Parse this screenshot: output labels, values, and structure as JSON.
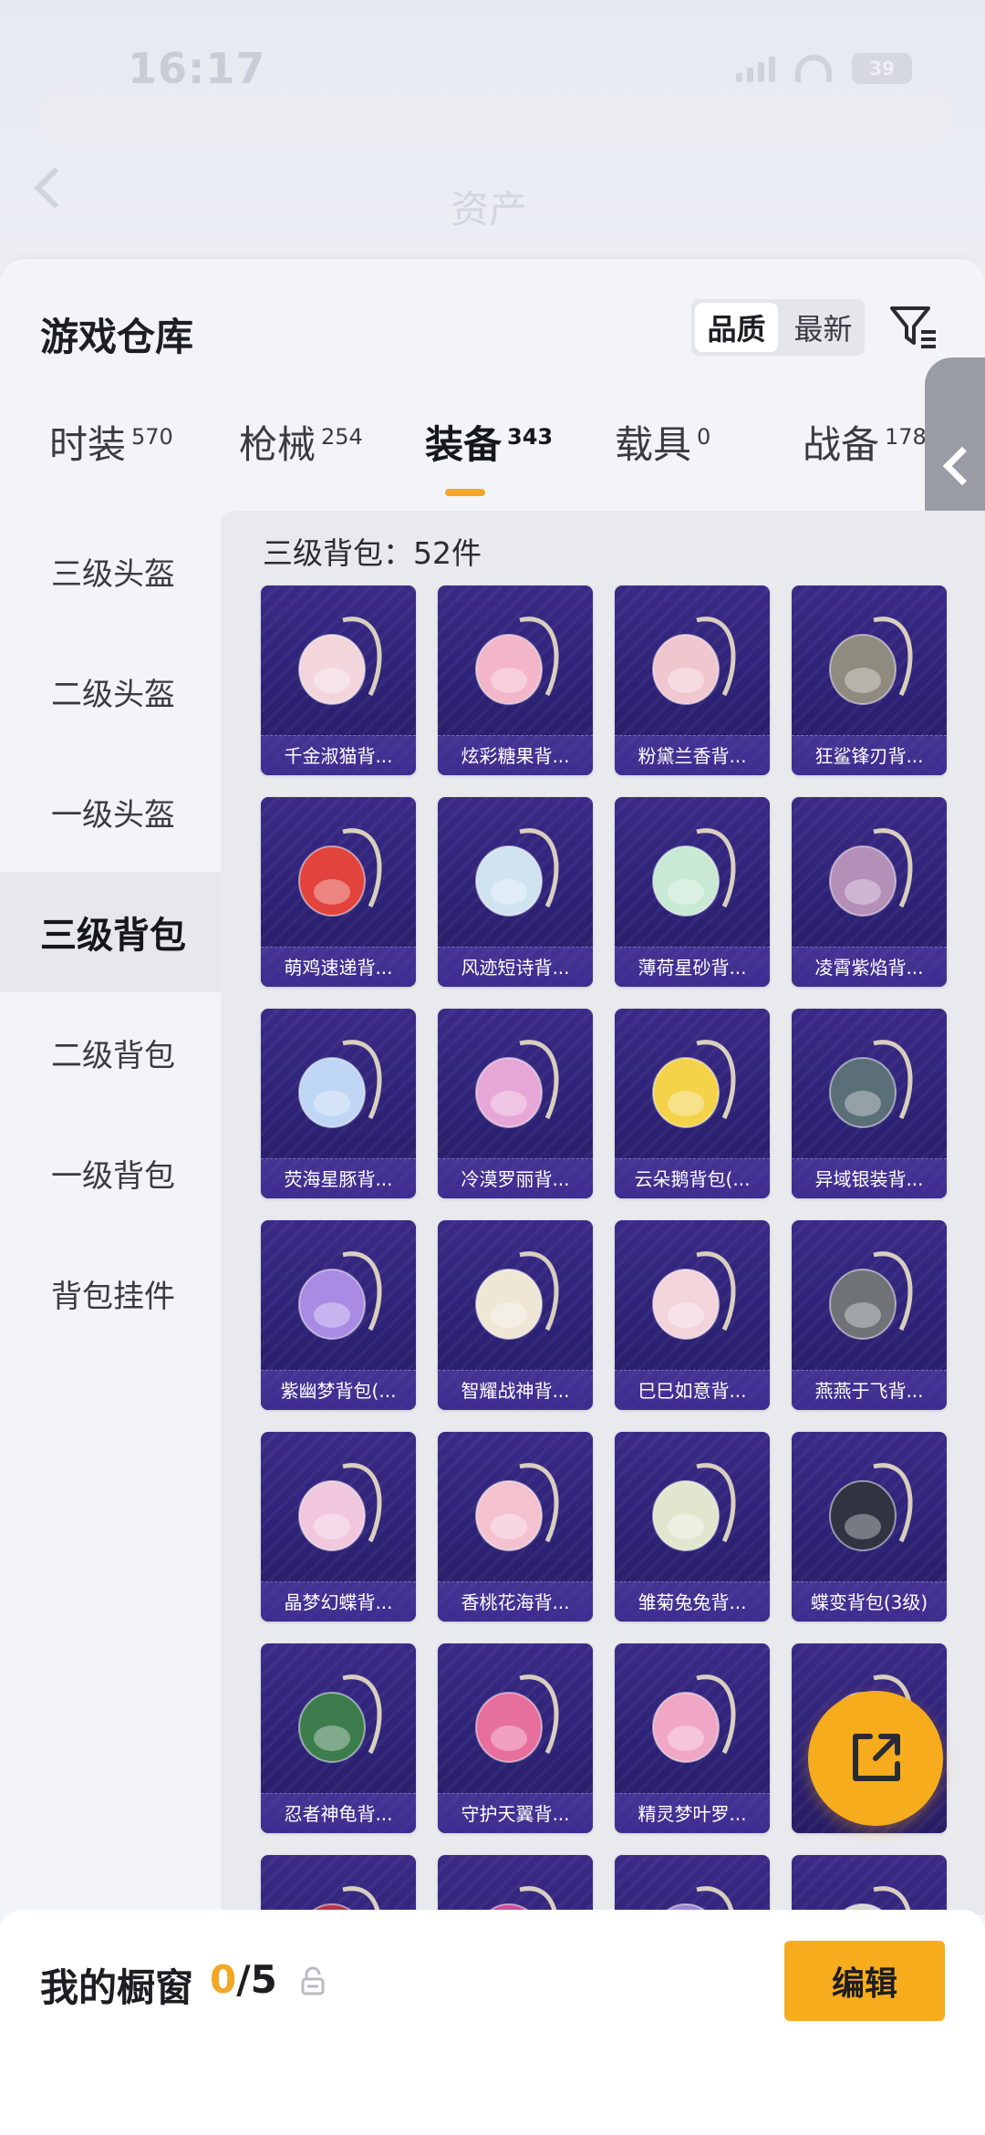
{
  "status": {
    "time": "16:17",
    "battery": "39"
  },
  "header": {
    "title": "资产"
  },
  "sheet": {
    "title": "游戏仓库",
    "sort_options": [
      {
        "label": "品质",
        "active": true
      },
      {
        "label": "最新",
        "active": false
      }
    ]
  },
  "tabs": [
    {
      "label": "时装",
      "count": "570"
    },
    {
      "label": "枪械",
      "count": "254"
    },
    {
      "label": "装备",
      "count": "343",
      "active": true
    },
    {
      "label": "载具",
      "count": "0"
    },
    {
      "label": "战备",
      "count": "178"
    }
  ],
  "categories": [
    {
      "label": "三级头盔"
    },
    {
      "label": "二级头盔"
    },
    {
      "label": "一级头盔"
    },
    {
      "label": "三级背包",
      "active": true
    },
    {
      "label": "二级背包"
    },
    {
      "label": "一级背包"
    },
    {
      "label": "背包挂件"
    }
  ],
  "group_title": "三级背包：52件",
  "items": [
    {
      "name": "千金淑猫背...",
      "color": "#f2d6dc"
    },
    {
      "name": "炫彩糖果背...",
      "color": "#f2b6c8"
    },
    {
      "name": "粉黛兰香背...",
      "color": "#f0c6cf"
    },
    {
      "name": "狂鲨锋刃背...",
      "color": "#8f8b7f"
    },
    {
      "name": "萌鸡速递背...",
      "color": "#e2433d"
    },
    {
      "name": "风迹短诗背...",
      "color": "#cfe3f1"
    },
    {
      "name": "薄荷星砂背...",
      "color": "#c8e9d3"
    },
    {
      "name": "凌霄紫焰背...",
      "color": "#b48fb8"
    },
    {
      "name": "荧海星豚背...",
      "color": "#bfd6f5"
    },
    {
      "name": "冷漠罗丽背...",
      "color": "#e6a7d6"
    },
    {
      "name": "云朵鹅背包(...",
      "color": "#f4d34a"
    },
    {
      "name": "异域银装背...",
      "color": "#5b6f78"
    },
    {
      "name": "紫幽梦背包(...",
      "color": "#a98be3"
    },
    {
      "name": "智耀战神背...",
      "color": "#efe6d6"
    },
    {
      "name": "巳巳如意背...",
      "color": "#f3d4db"
    },
    {
      "name": "燕燕于飞背...",
      "color": "#6f7378"
    },
    {
      "name": "晶梦幻蝶背...",
      "color": "#f1c7de"
    },
    {
      "name": "香桃花海背...",
      "color": "#f4c2cf"
    },
    {
      "name": "雏菊兔兔背...",
      "color": "#e3e6cf"
    },
    {
      "name": "蝶变背包(3级)",
      "color": "#2f3440"
    },
    {
      "name": "忍者神龟背...",
      "color": "#3d7d4d"
    },
    {
      "name": "守护天翼背...",
      "color": "#e76f9d"
    },
    {
      "name": "精灵梦叶罗...",
      "color": "#f0a7c6"
    },
    {
      "name": "",
      "color": "#efe9e2"
    },
    {
      "name": "",
      "color": "#b5344a"
    },
    {
      "name": "",
      "color": "#c64fa0"
    },
    {
      "name": "",
      "color": "#9a86d8"
    },
    {
      "name": "",
      "color": "#d8d4cf"
    }
  ],
  "showcase": {
    "label": "我的橱窗",
    "current": "0",
    "total": "/5"
  },
  "edit_button": "编辑",
  "icons": {
    "back": "chevron-left-icon",
    "filter": "filter-icon",
    "share": "share-icon",
    "lock": "lock-icon",
    "collapse": "chevron-left-icon"
  },
  "accent_color": "#f6ac1c"
}
